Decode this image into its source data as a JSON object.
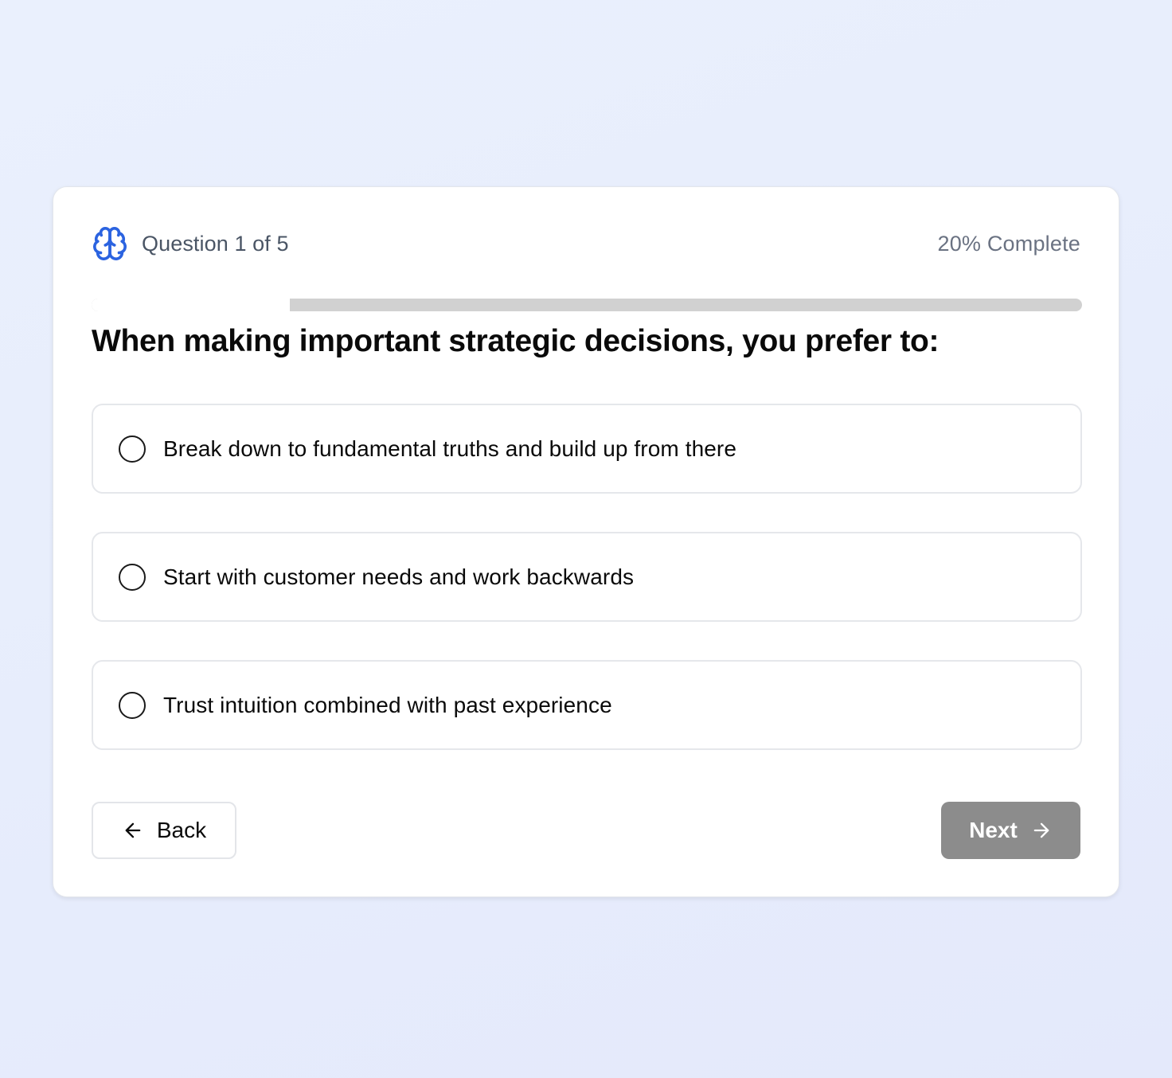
{
  "colors": {
    "accent": "#2b63e0",
    "progress_track": "#d1d1d1",
    "next_button": "#8c8c8c"
  },
  "header": {
    "icon": "brain-icon",
    "question_count": "Question 1 of 5",
    "progress_text": "20% Complete"
  },
  "progress": {
    "value": 0.2
  },
  "question": {
    "text": "When making important strategic decisions, you prefer to:"
  },
  "options": [
    {
      "label": "Break down to fundamental truths and build up from there",
      "selected": false
    },
    {
      "label": "Start with customer needs and work backwards",
      "selected": false
    },
    {
      "label": "Trust intuition combined with past experience",
      "selected": false
    }
  ],
  "footer": {
    "back_label": "Back",
    "back_icon": "arrow-left-icon",
    "next_label": "Next",
    "next_icon": "arrow-right-icon",
    "next_disabled": true
  }
}
